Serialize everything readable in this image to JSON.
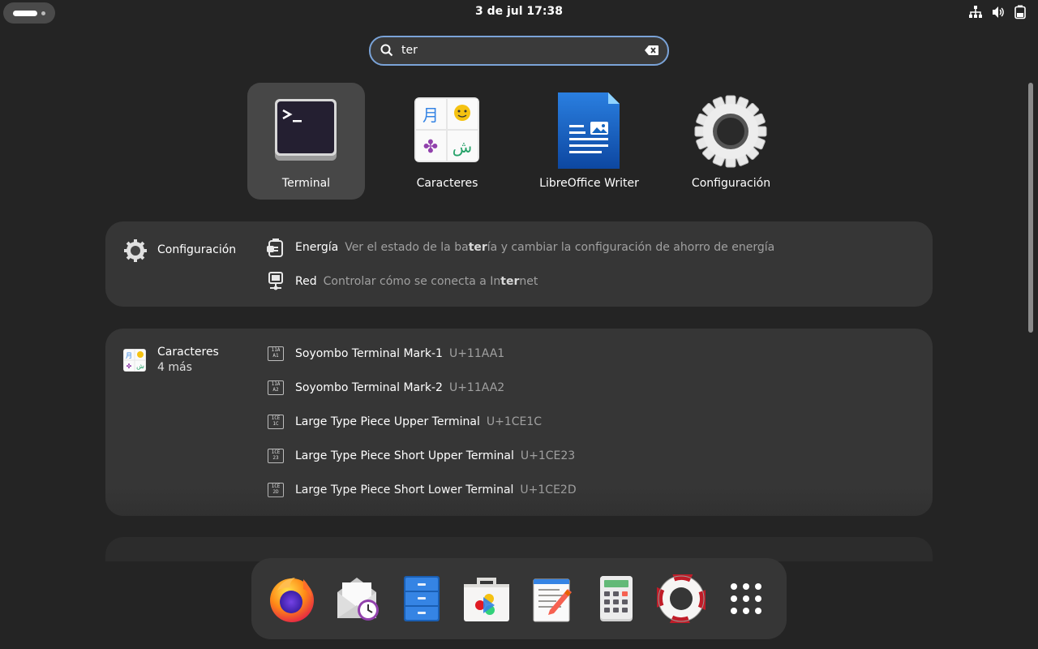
{
  "topbar": {
    "clock": "3 de jul  17:38",
    "tray_icons": [
      "network-icon",
      "volume-icon",
      "battery-icon"
    ]
  },
  "search": {
    "value": "ter"
  },
  "apps": [
    {
      "label": "Terminal",
      "icon": "terminal-icon",
      "selected": true
    },
    {
      "label": "Caracteres",
      "icon": "characters-icon",
      "selected": false
    },
    {
      "label": "LibreOffice Writer",
      "icon": "libreoffice-writer-icon",
      "selected": false
    },
    {
      "label": "Configuración",
      "icon": "settings-gear-icon",
      "selected": false
    }
  ],
  "settings_results": {
    "provider": "Configuración",
    "items": [
      {
        "title": "Energía",
        "desc_pre": "Ver el estado de la ba",
        "desc_match": "ter",
        "desc_post": "ía y cambiar la configuración de ahorro de energía",
        "icon": "power-icon"
      },
      {
        "title": "Red",
        "desc_pre": "Controlar cómo se conecta a In",
        "desc_match": "ter",
        "desc_post": "net",
        "icon": "network-wired-icon"
      }
    ]
  },
  "characters_results": {
    "provider": "Caracteres",
    "more": "4 más",
    "items": [
      {
        "title": "Soyombo Terminal Mark-1",
        "code": "U+11AA1",
        "hex": "11AA1"
      },
      {
        "title": "Soyombo Terminal Mark-2",
        "code": "U+11AA2",
        "hex": "11AA2"
      },
      {
        "title": "Large Type Piece Upper Terminal",
        "code": "U+1CE1C",
        "hex": "1CE1C"
      },
      {
        "title": "Large Type Piece Short Upper Terminal",
        "code": "U+1CE23",
        "hex": "1CE23"
      },
      {
        "title": "Large Type Piece Short Lower Terminal",
        "code": "U+1CE2D",
        "hex": "1CE2D"
      }
    ]
  },
  "dock": [
    "firefox-icon",
    "evolution-mail-icon",
    "files-icon",
    "software-icon",
    "text-editor-icon",
    "calculator-icon",
    "help-icon",
    "show-apps-icon"
  ],
  "colors": {
    "background": "#242424",
    "panel": "#363636",
    "accent": "#7aa3d8"
  }
}
